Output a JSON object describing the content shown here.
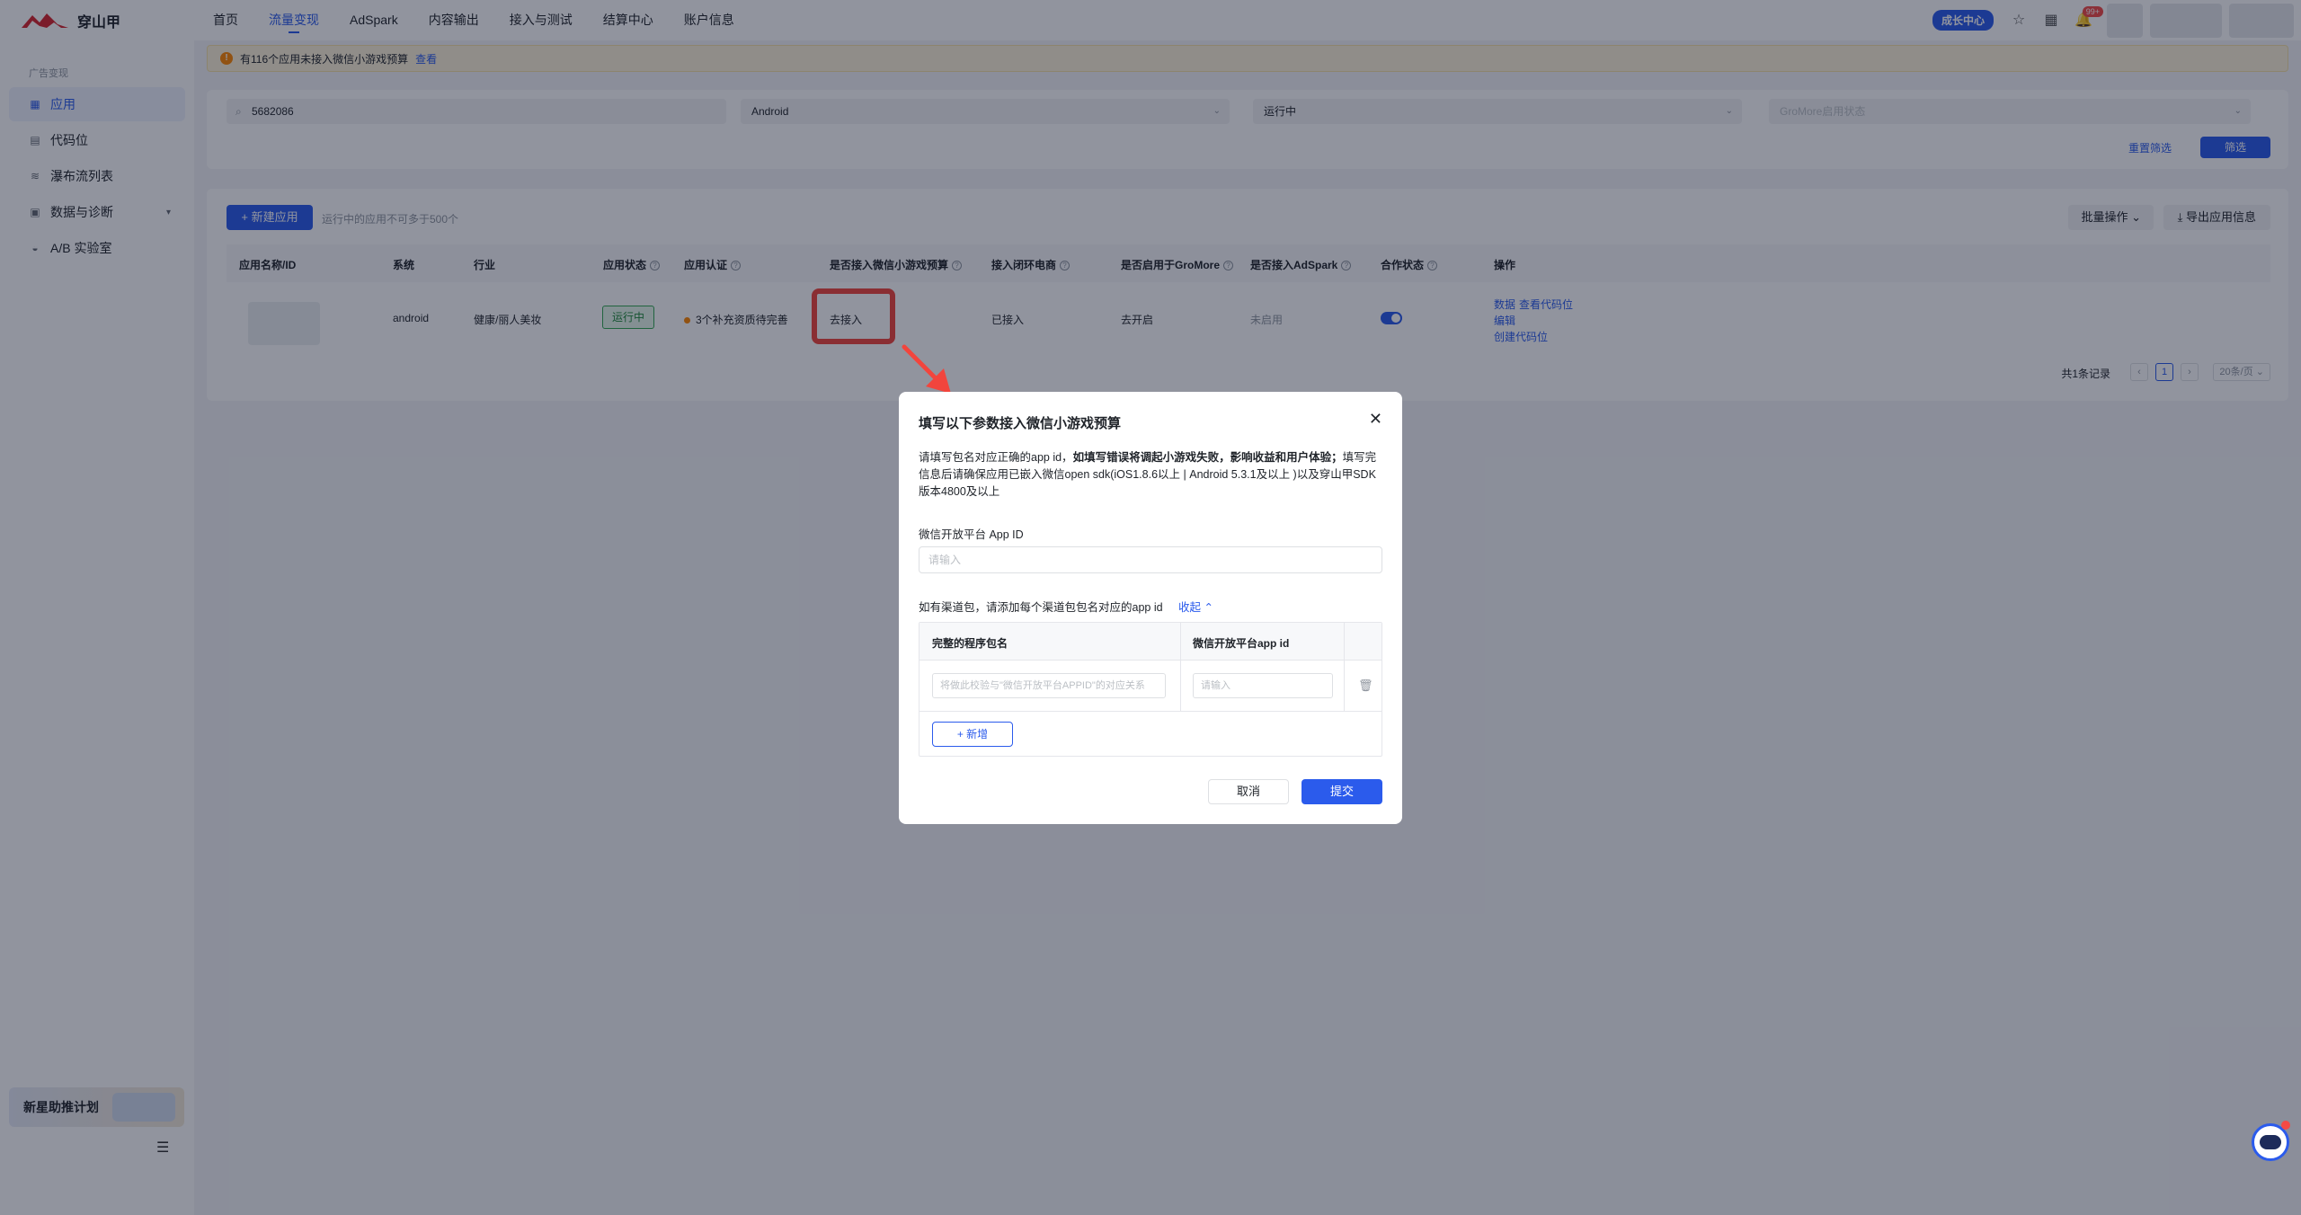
{
  "brand": {
    "name": "穿山甲"
  },
  "nav": {
    "items": [
      "首页",
      "流量变现",
      "AdSpark",
      "内容输出",
      "接入与测试",
      "结算中心",
      "账户信息"
    ],
    "active_index": 1
  },
  "topbar": {
    "growth_center": "成长中心",
    "notification_badge": "99+"
  },
  "sidebar": {
    "group_label": "广告变现",
    "items": [
      {
        "label": "应用",
        "icon": "grid-icon",
        "active": true
      },
      {
        "label": "代码位",
        "icon": "code-slot-icon"
      },
      {
        "label": "瀑布流列表",
        "icon": "layers-icon"
      },
      {
        "label": "数据与诊断",
        "icon": "chart-icon",
        "expandable": true
      },
      {
        "label": "A/B 实验室",
        "icon": "lab-icon"
      }
    ],
    "promo": "新星助推计划"
  },
  "notice": {
    "text": "有116个应用未接入微信小游戏预算",
    "link": "查看"
  },
  "filters": {
    "search_value": "5682086",
    "system_value": "Android",
    "status_value": "运行中",
    "gromore_placeholder": "GroMore启用状态",
    "reset": "重置筛选",
    "submit": "筛选"
  },
  "apps_table": {
    "new_app": "+ 新建应用",
    "limit_hint": "运行中的应用不可多于500个",
    "batch": "批量操作",
    "export": "导出应用信息",
    "columns": [
      "应用名称/ID",
      "系统",
      "行业",
      "应用状态",
      "应用认证",
      "是否接入微信小游戏预算",
      "接入闭环电商",
      "是否启用于GroMore",
      "是否接入AdSpark",
      "合作状态",
      "操作"
    ],
    "row": {
      "system": "android",
      "industry": "健康/丽人美妆",
      "status": "运行中",
      "certification": "3个补充资质待完善",
      "wechat_game": "去接入",
      "ecommerce": "已接入",
      "gromore": "去开启",
      "adspark": "未启用",
      "cooperation_on": true,
      "ops": [
        "数据",
        "查看代码位",
        "编辑",
        "创建代码位"
      ]
    },
    "pagination": {
      "total": "共1条记录",
      "current": "1",
      "page_size": "20条/页"
    }
  },
  "modal": {
    "title": "填写以下参数接入微信小游戏预算",
    "desc_pre": "请填写包名对应正确的app id，",
    "desc_bold": "如填写错误将调起小游戏失败，影响收益和用户体验；",
    "desc_post": "填写完信息后请确保应用已嵌入微信open sdk(iOS1.8.6以上 | Android 5.3.1及以上 )以及穿山甲SDK版本4800及以上",
    "appid_label": "微信开放平台 App ID",
    "appid_placeholder": "请输入",
    "channel_label": "如有渠道包，请添加每个渠道包包名对应的app id",
    "collapse": "收起",
    "table_headers": [
      "完整的程序包名",
      "微信开放平台app id"
    ],
    "package_placeholder": "将做此校验与\"微信开放平台APPID\"的对应关系",
    "channel_appid_placeholder": "请输入",
    "add": "+ 新增",
    "cancel": "取消",
    "submit": "提交"
  }
}
